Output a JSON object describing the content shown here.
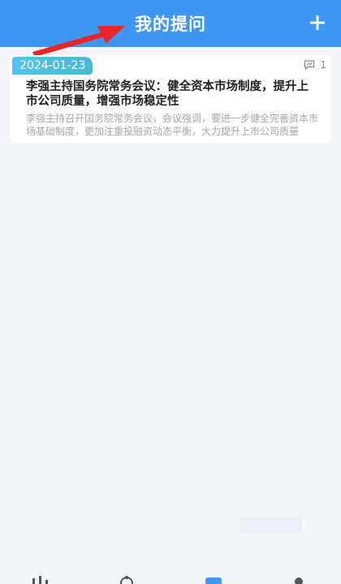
{
  "header": {
    "title": "我的提问",
    "add_icon": "plus-icon",
    "background": "#3f97f1"
  },
  "questions": [
    {
      "date": "2024-01-23",
      "reply_count": "1",
      "reply_icon": "comment-icon",
      "title": "李强主持国务院常务会议：健全资本市场制度，提升上市公司质量，增强市场稳定性",
      "summary": "李强主持召开国务院常务会议，会议强调，要进一步健全完善资本市场基础制度，更加注重投融资动态平衡，大力提升上市公司质量"
    }
  ],
  "tabbar": {
    "icons": [
      "stock-chart-icon",
      "gear-icon",
      "question-icon",
      "profile-icon"
    ]
  },
  "colors": {
    "accent": "#3f97f1",
    "badge_start": "#52c3f4",
    "badge_end": "#4ab9cf",
    "arrow": "#e8262a"
  }
}
